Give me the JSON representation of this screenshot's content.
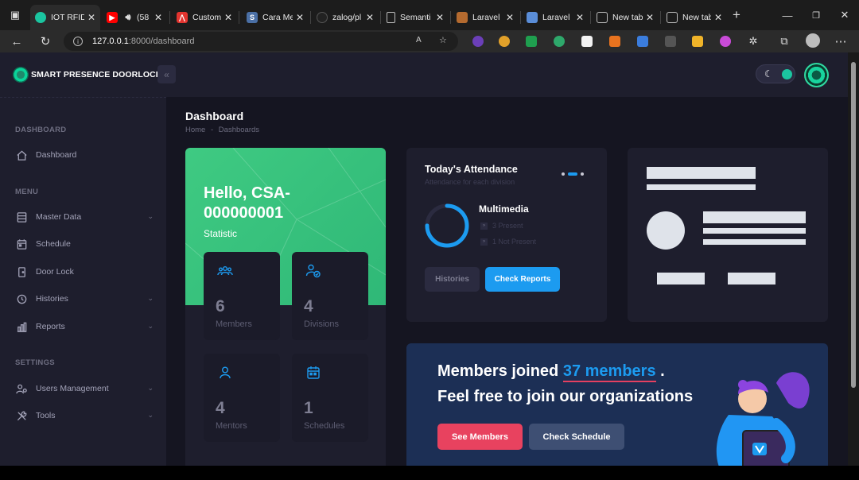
{
  "browser": {
    "tabs": [
      {
        "title": "IOT RFID",
        "icon": "green-globe-icon",
        "color": "#1bc5a0",
        "active": true
      },
      {
        "title": "(58",
        "icon": "youtube-icon",
        "color": "#ff0000",
        "active": false
      },
      {
        "title": "Custom",
        "icon": "laravel-icon",
        "color": "#e3342f",
        "active": false
      },
      {
        "title": "Cara Me",
        "icon": "s-icon",
        "color": "#4a6fa5",
        "active": false
      },
      {
        "title": "zalog/pl",
        "icon": "github-icon",
        "color": "#333333",
        "active": false
      },
      {
        "title": "Semanti",
        "icon": "document-icon",
        "color": "#777777",
        "active": false
      },
      {
        "title": "Laravel",
        "icon": "laracasts-icon",
        "color": "#b46a2f",
        "active": false
      },
      {
        "title": "Laravel",
        "icon": "laravel-daily-icon",
        "color": "#5a8dd8",
        "active": false
      },
      {
        "title": "New tab",
        "icon": "newtab-icon",
        "color": "#777777",
        "active": false
      },
      {
        "title": "New tab",
        "icon": "newtab-icon",
        "color": "#777777",
        "active": false
      }
    ],
    "url_host": "127.0.0.1",
    "url_path": ":8000/dashboard"
  },
  "app": {
    "brand": "SMART PRESENCE DOORLOCK",
    "accent": "#1bc5a0"
  },
  "sidebar": {
    "sections": [
      {
        "title": "DASHBOARD"
      },
      {
        "title": "MENU"
      },
      {
        "title": "SETTINGS"
      }
    ],
    "items": [
      {
        "label": "Dashboard",
        "icon": "home-icon",
        "has_sub": false
      },
      {
        "label": "Master Data",
        "icon": "database-icon",
        "has_sub": true
      },
      {
        "label": "Schedule",
        "icon": "calendar-icon",
        "has_sub": false
      },
      {
        "label": "Door Lock",
        "icon": "door-icon",
        "has_sub": false
      },
      {
        "label": "Histories",
        "icon": "history-icon",
        "has_sub": true
      },
      {
        "label": "Reports",
        "icon": "chart-icon",
        "has_sub": true
      },
      {
        "label": "Users Management",
        "icon": "users-gear-icon",
        "has_sub": true
      },
      {
        "label": "Tools",
        "icon": "tools-icon",
        "has_sub": true
      }
    ]
  },
  "page": {
    "title": "Dashboard",
    "breadcrumb_home": "Home",
    "breadcrumb_sep": "-",
    "breadcrumb_current": "Dashboards"
  },
  "welcome": {
    "greeting": "Hello, CSA-000000001",
    "subtitle": "Statistic",
    "stats": [
      {
        "value": "6",
        "label": "Members",
        "icon": "people-icon"
      },
      {
        "value": "4",
        "label": "Divisions",
        "icon": "user-check-icon"
      },
      {
        "value": "4",
        "label": "Mentors",
        "icon": "user-icon"
      },
      {
        "value": "1",
        "label": "Schedules",
        "icon": "calendar-icon"
      }
    ]
  },
  "attendance": {
    "title": "Today's Attendance",
    "subtitle": "Attendance for each division",
    "division": "Multimedia",
    "present": "3 Present",
    "not_present": "1 Not Present",
    "present_fraction": 0.75,
    "histories_label": "Histories",
    "check_reports_label": "Check Reports"
  },
  "banner": {
    "line1_prefix": "Members joined",
    "line1_highlight": "37 members",
    "line1_suffix": ".",
    "line2": "Feel free to join our organizations",
    "see_members_label": "See Members",
    "check_schedule_label": "Check Schedule"
  }
}
